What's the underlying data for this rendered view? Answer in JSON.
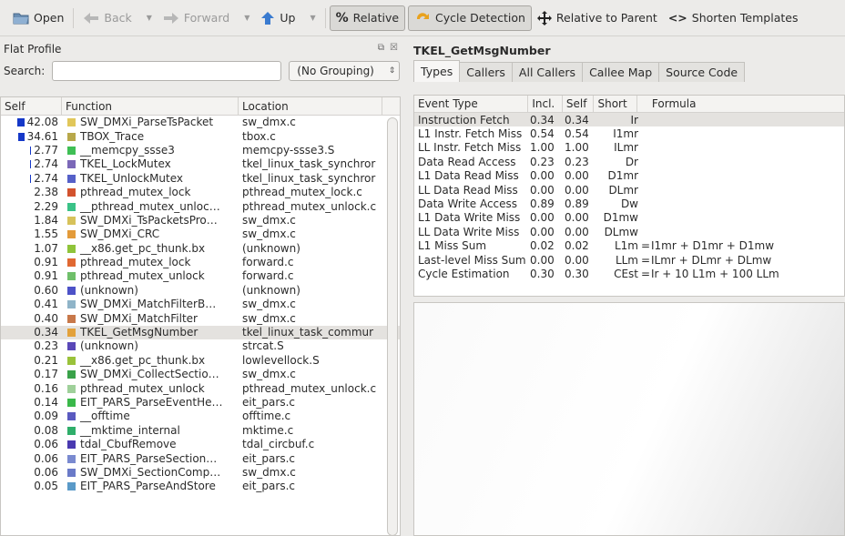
{
  "toolbar": {
    "open": "Open",
    "back": "Back",
    "forward": "Forward",
    "up": "Up",
    "relative": "Relative",
    "cycle": "Cycle Detection",
    "rel_parent": "Relative to Parent",
    "shorten": "Shorten Templates"
  },
  "flat": {
    "title": "Flat Profile",
    "search_label": "Search:",
    "search_value": "",
    "grouping": "(No Grouping)",
    "columns": [
      "Self",
      "Function",
      "Location"
    ],
    "rows": [
      {
        "self": "42.08",
        "pct": 42.08,
        "color": "#e1c75a",
        "fn": "SW_DMXi_ParseTsPacket",
        "loc": "sw_dmx.c"
      },
      {
        "self": "34.61",
        "pct": 34.61,
        "color": "#b8a84a",
        "fn": "TBOX_Trace",
        "loc": "tbox.c"
      },
      {
        "self": "2.77",
        "pct": 2.77,
        "color": "#3fbf55",
        "fn": "__memcpy_ssse3",
        "loc": "memcpy-ssse3.S"
      },
      {
        "self": "2.74",
        "pct": 2.74,
        "color": "#7b68b8",
        "fn": "TKEL_LockMutex",
        "loc": "tkel_linux_task_synchror"
      },
      {
        "self": "2.74",
        "pct": 2.74,
        "color": "#5560c8",
        "fn": "TKEL_UnlockMutex",
        "loc": "tkel_linux_task_synchror"
      },
      {
        "self": "2.38",
        "pct": 2.38,
        "color": "#d2522e",
        "fn": "pthread_mutex_lock",
        "loc": "pthread_mutex_lock.c"
      },
      {
        "self": "2.29",
        "pct": 2.29,
        "color": "#3ac287",
        "fn": "__pthread_mutex_unloc…",
        "loc": "pthread_mutex_unlock.c"
      },
      {
        "self": "1.84",
        "pct": 1.84,
        "color": "#d7c25b",
        "fn": "SW_DMXi_TsPacketsPro…",
        "loc": "sw_dmx.c"
      },
      {
        "self": "1.55",
        "pct": 1.55,
        "color": "#e39b3a",
        "fn": "SW_DMXi_CRC",
        "loc": "sw_dmx.c"
      },
      {
        "self": "1.07",
        "pct": 1.07,
        "color": "#8fc43a",
        "fn": "__x86.get_pc_thunk.bx",
        "loc": "(unknown)"
      },
      {
        "self": "0.91",
        "pct": 0.91,
        "color": "#e06832",
        "fn": "pthread_mutex_lock",
        "loc": "forward.c"
      },
      {
        "self": "0.91",
        "pct": 0.91,
        "color": "#6fbf6a",
        "fn": "pthread_mutex_unlock",
        "loc": "forward.c"
      },
      {
        "self": "0.60",
        "pct": 0.6,
        "color": "#4d52c8",
        "fn": "(unknown)",
        "loc": "(unknown)"
      },
      {
        "self": "0.41",
        "pct": 0.41,
        "color": "#8fb4c8",
        "fn": "SW_DMXi_MatchFilterB…",
        "loc": "sw_dmx.c"
      },
      {
        "self": "0.40",
        "pct": 0.4,
        "color": "#c8784a",
        "fn": "SW_DMXi_MatchFilter",
        "loc": "sw_dmx.c"
      },
      {
        "self": "0.34",
        "pct": 0.34,
        "color": "#e3a13a",
        "fn": "TKEL_GetMsgNumber",
        "loc": "tkel_linux_task_commur"
      },
      {
        "self": "0.23",
        "pct": 0.23,
        "color": "#5a48b8",
        "fn": "(unknown)",
        "loc": "strcat.S"
      },
      {
        "self": "0.21",
        "pct": 0.21,
        "color": "#9ac23a",
        "fn": "__x86.get_pc_thunk.bx",
        "loc": "lowlevellock.S"
      },
      {
        "self": "0.17",
        "pct": 0.17,
        "color": "#3aa24a",
        "fn": "SW_DMXi_CollectSectio…",
        "loc": "sw_dmx.c"
      },
      {
        "self": "0.16",
        "pct": 0.16,
        "color": "#9fd09a",
        "fn": "pthread_mutex_unlock",
        "loc": "pthread_mutex_unlock.c"
      },
      {
        "self": "0.14",
        "pct": 0.14,
        "color": "#3ab84a",
        "fn": "EIT_PARS_ParseEventHe…",
        "loc": "eit_pars.c"
      },
      {
        "self": "0.09",
        "pct": 0.09,
        "color": "#5a5ac0",
        "fn": "__offtime",
        "loc": "offtime.c"
      },
      {
        "self": "0.08",
        "pct": 0.08,
        "color": "#2fae6a",
        "fn": "__mktime_internal",
        "loc": "mktime.c"
      },
      {
        "self": "0.06",
        "pct": 0.06,
        "color": "#4a3ab0",
        "fn": "tdal_CbufRemove",
        "loc": "tdal_circbuf.c"
      },
      {
        "self": "0.06",
        "pct": 0.06,
        "color": "#7a8ad0",
        "fn": "EIT_PARS_ParseSection…",
        "loc": "eit_pars.c"
      },
      {
        "self": "0.06",
        "pct": 0.06,
        "color": "#6a7ac8",
        "fn": "SW_DMXi_SectionComp…",
        "loc": "sw_dmx.c"
      },
      {
        "self": "0.05",
        "pct": 0.05,
        "color": "#5a9ac8",
        "fn": "EIT_PARS_ParseAndStore",
        "loc": "eit_pars.c"
      }
    ]
  },
  "detail": {
    "title": "TKEL_GetMsgNumber",
    "tabs": [
      "Types",
      "Callers",
      "All Callers",
      "Callee Map",
      "Source Code"
    ],
    "columns": [
      "Event Type",
      "Incl.",
      "Self",
      "Short",
      "Formula"
    ],
    "rows": [
      {
        "type": "Instruction Fetch",
        "incl": "0.34",
        "self": "0.34",
        "short": "Ir",
        "eq": "",
        "formula": ""
      },
      {
        "type": "L1 Instr. Fetch Miss",
        "incl": "0.54",
        "self": "0.54",
        "short": "I1mr",
        "eq": "",
        "formula": ""
      },
      {
        "type": "LL Instr. Fetch Miss",
        "incl": "1.00",
        "self": "1.00",
        "short": "ILmr",
        "eq": "",
        "formula": ""
      },
      {
        "type": "Data Read Access",
        "incl": "0.23",
        "self": "0.23",
        "short": "Dr",
        "eq": "",
        "formula": ""
      },
      {
        "type": "L1 Data Read Miss",
        "incl": "0.00",
        "self": "0.00",
        "short": "D1mr",
        "eq": "",
        "formula": ""
      },
      {
        "type": "LL Data Read Miss",
        "incl": "0.00",
        "self": "0.00",
        "short": "DLmr",
        "eq": "",
        "formula": ""
      },
      {
        "type": "Data Write Access",
        "incl": "0.89",
        "self": "0.89",
        "short": "Dw",
        "eq": "",
        "formula": ""
      },
      {
        "type": "L1 Data Write Miss",
        "incl": "0.00",
        "self": "0.00",
        "short": "D1mw",
        "eq": "",
        "formula": ""
      },
      {
        "type": "LL Data Write Miss",
        "incl": "0.00",
        "self": "0.00",
        "short": "DLmw",
        "eq": "",
        "formula": ""
      },
      {
        "type": "L1 Miss Sum",
        "incl": "0.02",
        "self": "0.02",
        "short": "L1m",
        "eq": "=",
        "formula": "I1mr + D1mr + D1mw"
      },
      {
        "type": "Last-level Miss Sum",
        "incl": "0.00",
        "self": "0.00",
        "short": "LLm",
        "eq": "=",
        "formula": "ILmr + DLmr + DLmw"
      },
      {
        "type": "Cycle Estimation",
        "incl": "0.30",
        "self": "0.30",
        "short": "CEst",
        "eq": "=",
        "formula": "Ir + 10 L1m + 100 LLm"
      }
    ]
  }
}
